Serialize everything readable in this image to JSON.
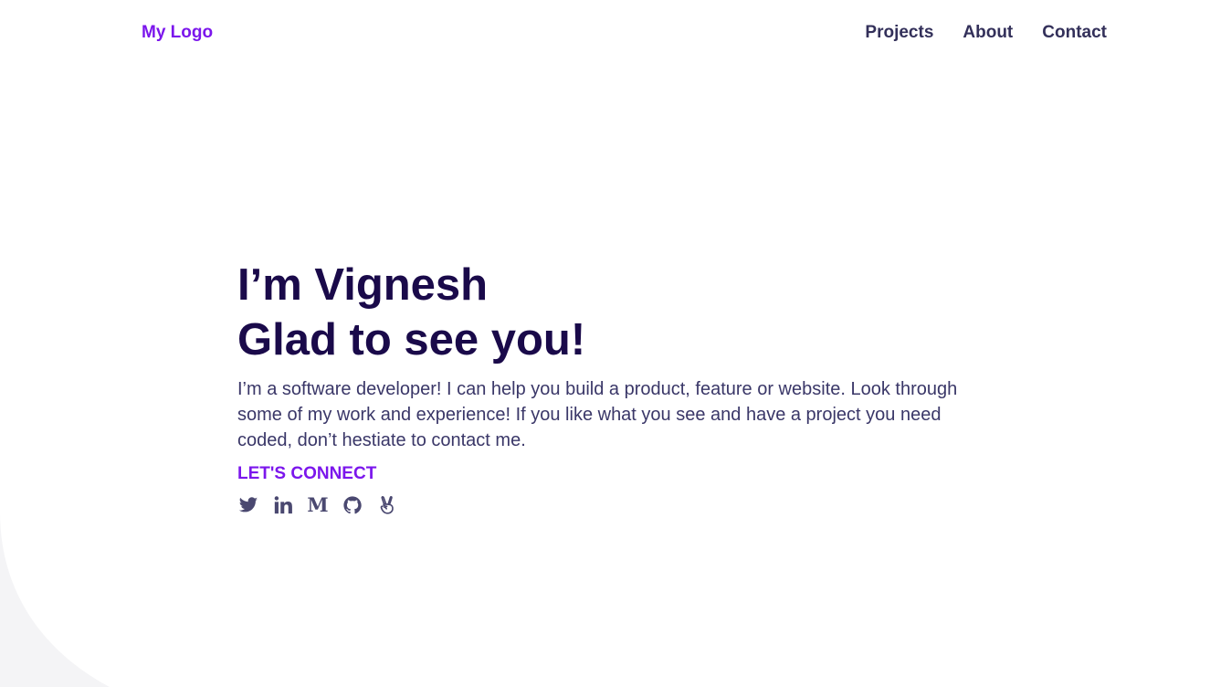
{
  "header": {
    "logo": "My Logo",
    "nav": [
      {
        "label": "Projects"
      },
      {
        "label": "About"
      },
      {
        "label": "Contact"
      }
    ]
  },
  "hero": {
    "title_line1": "I’m Vignesh",
    "title_line2": "Glad to see you!",
    "description": "I’m a software developer! I can help you build a product, feature or website. Look through some of my work and experience! If you like what you see and have a project you need coded, don’t hestiate to contact me.",
    "connect_label": "LET'S CONNECT",
    "socials": [
      {
        "icon": "twitter-icon"
      },
      {
        "icon": "linkedin-icon"
      },
      {
        "icon": "medium-icon",
        "glyph": "M"
      },
      {
        "icon": "github-icon"
      },
      {
        "icon": "angellist-icon"
      }
    ]
  },
  "colors": {
    "accent": "#7b16ec",
    "heading": "#1a0a4a",
    "text": "#3a3768",
    "nav": "#33305a",
    "background_shape": "#f4f4f6"
  }
}
